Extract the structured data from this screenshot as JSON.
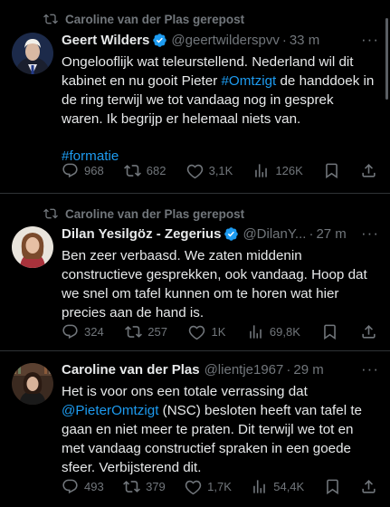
{
  "tweets": [
    {
      "repost_label": "Caroline van der Plas gerepost",
      "name": "Geert Wilders",
      "verified": true,
      "handle": "@geertwilderspvv",
      "dot": "·",
      "time": "33 m",
      "body": {
        "t1": "Ongelooflijk wat teleurstellend. Nederland wil dit kabinet en nu gooit Pieter ",
        "hashtag": "#Omtzigt",
        "t2": " de handdoek in de ring terwijl we tot vandaag nog in gesprek waren. Ik begrijp er helemaal niets van.",
        "hashtag2": "#formatie"
      },
      "replies": "968",
      "reposts": "682",
      "likes": "3,1K",
      "views": "126K"
    },
    {
      "repost_label": "Caroline van der Plas gerepost",
      "name": "Dilan Yesilgöz - Zegerius",
      "verified": true,
      "handle": "@DilanY...",
      "dot": "·",
      "time": "27 m",
      "body": {
        "text": "Ben zeer verbaasd. We zaten middenin constructieve gesprekken, ook vandaag. Hoop dat we snel om tafel kunnen om te horen wat hier precies aan de hand is."
      },
      "replies": "324",
      "reposts": "257",
      "likes": "1K",
      "views": "69,8K"
    },
    {
      "name": "Caroline van der Plas",
      "verified": false,
      "handle": "@lientje1967",
      "dot": "·",
      "time": "29 m",
      "body": {
        "t1": "Het is voor ons een totale verrassing dat ",
        "mention": "@PieterOmtzigt",
        "t2": " (NSC) besloten heeft van tafel te gaan en niet meer te praten. Dit terwijl we tot en met vandaag constructief spraken in een goede sfeer. Verbijsterend dit."
      },
      "replies": "493",
      "reposts": "379",
      "likes": "1,7K",
      "views": "54,4K"
    }
  ]
}
